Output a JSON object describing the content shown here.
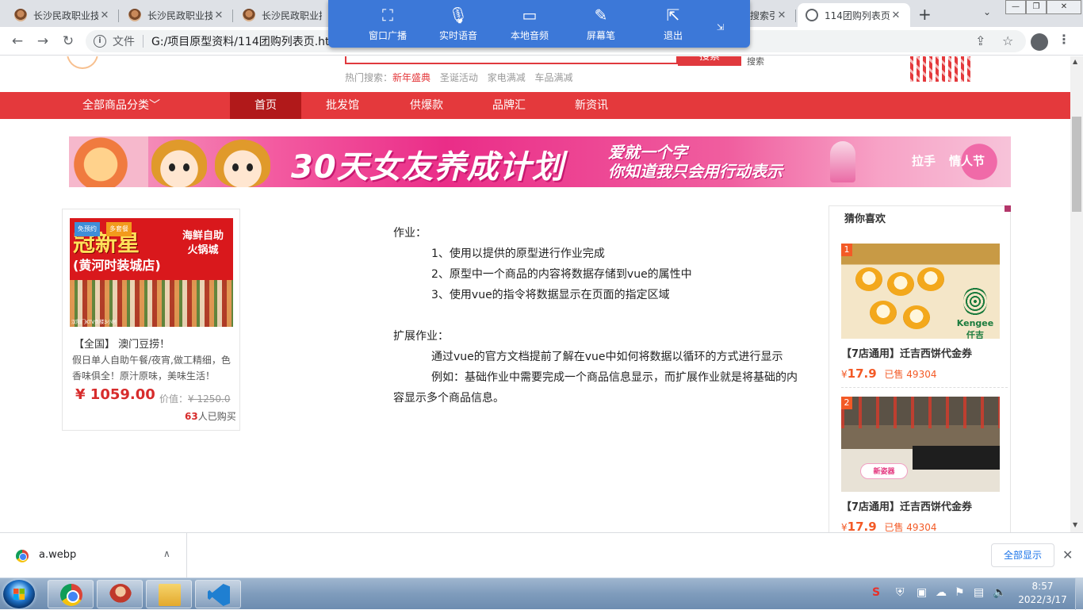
{
  "browser": {
    "tabs": [
      {
        "title": "长沙民政职业技"
      },
      {
        "title": "长沙民政职业技"
      },
      {
        "title": "长沙民政职业技"
      },
      {
        "title": "搜索引"
      },
      {
        "title": "114团购列表页"
      }
    ],
    "address": {
      "scheme_label": "文件",
      "url": "G:/项目原型资料/114团购列表页.html"
    }
  },
  "share_toolbar": {
    "items": [
      {
        "label": "窗口广播",
        "icon": "screen-broadcast-icon"
      },
      {
        "label": "实时语音",
        "icon": "microphone-icon"
      },
      {
        "label": "本地音频",
        "icon": "speaker-monitor-icon"
      },
      {
        "label": "屏幕笔",
        "icon": "pen-icon"
      },
      {
        "label": "退出",
        "icon": "exit-icon"
      }
    ]
  },
  "site": {
    "search": {
      "button": "搜索",
      "link": "搜索"
    },
    "hot": {
      "label": "热门搜索：",
      "items": [
        "新年盛典",
        "圣诞活动",
        "家电满减",
        "车品满减"
      ]
    },
    "nav": {
      "all": "全部商品分类﹀",
      "items": [
        "首页",
        "批发馆",
        "供爆款",
        "品牌汇",
        "新资讯"
      ]
    },
    "banner": {
      "headline": "30天女友养成计划",
      "sub1": "爱就一个字",
      "sub2": "你知道我只会用行动表示",
      "tag1": "拉手",
      "tag2": "情人节"
    },
    "product": {
      "badges": [
        "免预约",
        "多套餐"
      ],
      "image_title": "冠新星",
      "image_sub": "(黄河时装城店)",
      "image_side1": "海鲜自助",
      "image_side2": "火锅城",
      "image_foot": "汉阳门KTV负楼3小时",
      "title": "【全国】 澳门豆捞！",
      "desc": "假日单人自助午餐/夜宵,做工精细，色香味俱全！原汁原味，美味生活！",
      "price": "¥ 1059.00",
      "orig_label": "价值：",
      "orig_price": "¥ 1250.0",
      "sold_count": "63",
      "sold_suffix": "人已购买"
    },
    "homework": {
      "title": "作业：",
      "items": [
        "1、使用以提供的原型进行作业完成",
        "2、原型中一个商品的内容将数据存储到vue的属性中",
        "3、使用vue的指令将数据显示在页面的指定区域"
      ],
      "ext_title": "扩展作业：",
      "ext_p1": "通过vue的官方文档提前了解在vue中如何将数据以循环的方式进行显示",
      "ext_p2": "例如：基础作业中需要完成一个商品信息显示，而扩展作业就是将基础的内容显示多个商品信息。"
    },
    "guess": {
      "title": "猜你喜欢",
      "items": [
        {
          "rank": "1",
          "name": "【7店通用】迁吉西饼代金券",
          "yen": "¥",
          "price": "17.9",
          "sold": "已售 49304",
          "brand": "Kengee 仟吉"
        },
        {
          "rank": "2",
          "name": "【7店通用】迁吉西饼代金券",
          "yen": "¥",
          "price": "17.9",
          "sold": "已售 49304",
          "brand": "新姿器"
        }
      ]
    }
  },
  "download_bar": {
    "file": "a.webp",
    "show_all": "全部显示"
  },
  "taskbar": {
    "time": "8:57",
    "date": "2022/3/17"
  }
}
